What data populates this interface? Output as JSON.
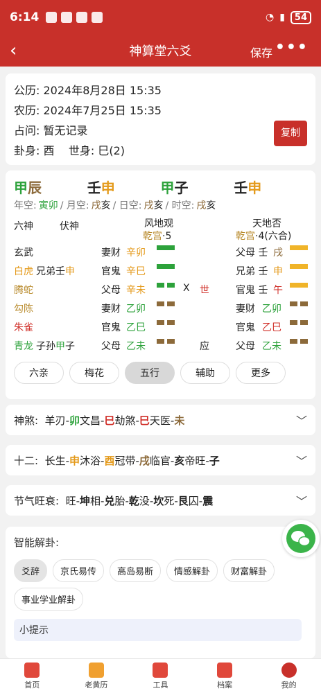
{
  "status": {
    "time": "6:14",
    "battery": "54"
  },
  "nav": {
    "back": "‹",
    "title": "神算堂六爻",
    "save": "保存",
    "more": "•••"
  },
  "info": {
    "gongli_label": "公历:",
    "gongli": "2024年8月28日 15:35",
    "nongli_label": "农历:",
    "nongli": "2024年7月25日 15:35",
    "zhanwen_label": "占问:",
    "zhanwen": "暂无记录",
    "guashen_label": "卦身:",
    "guashen": "酉",
    "shishen_label": "世身:",
    "shishen": "巳(2)",
    "copy": "复制"
  },
  "ganzhi": [
    {
      "gan": "甲",
      "zhi": "辰"
    },
    {
      "gan": "壬",
      "zhi": "申"
    },
    {
      "gan": "甲",
      "zhi": "子"
    },
    {
      "gan": "壬",
      "zhi": "申"
    }
  ],
  "kong": {
    "nian_label": "年空:",
    "nian": "寅卯",
    "yue_label": "/ 月空:",
    "yue_a": "戌",
    "yue_b": "亥",
    "ri_label": "/ 日空:",
    "ri_a": "戌",
    "ri_b": "亥",
    "shi_label": "/ 时空:",
    "shi_a": "戌",
    "shi_b": "亥"
  },
  "head": {
    "liushen": "六神",
    "fushen": "伏神",
    "ben_name": "风地观",
    "ben_gong": "乾宫",
    "ben_num": "·5",
    "bian_name": "天地否",
    "bian_gong": "乾宫",
    "bian_num": "·4(六合)"
  },
  "yao": [
    {
      "shen": "玄武",
      "fu": "",
      "fu_zhi": "",
      "fu_rest": "",
      "ben_a": "妻财",
      "ben_b": "辛卯",
      "line": "yang-g",
      "mark": "",
      "bian_a": "父母 壬",
      "bian_b": "戌",
      "bline": "yang-o"
    },
    {
      "shen": "白虎",
      "fu": "兄弟壬",
      "fu_zhi": "申",
      "fu_rest": "",
      "ben_a": "官鬼",
      "ben_b": "辛巳",
      "line": "yang-g",
      "mark": "",
      "bian_a": "兄弟 壬",
      "bian_b": "申",
      "bline": "yang-o"
    },
    {
      "shen": "腾蛇",
      "fu": "",
      "fu_zhi": "",
      "fu_rest": "",
      "ben_a": "父母",
      "ben_b": "辛未",
      "line": "yin-g",
      "mark": "X",
      "shi": "世",
      "bian_a": "官鬼 壬",
      "bian_b": "午",
      "bline": "yang-o"
    },
    {
      "shen": "勾陈",
      "fu": "",
      "fu_zhi": "",
      "fu_rest": "",
      "ben_a": "妻财",
      "ben_b": "乙卯",
      "line": "yin-b",
      "mark": "",
      "bian_a": "妻财",
      "bian_b": "乙卯",
      "bline": "yin-b"
    },
    {
      "shen": "朱雀",
      "fu": "",
      "fu_zhi": "",
      "fu_rest": "",
      "ben_a": "官鬼",
      "ben_b": "乙巳",
      "line": "yin-b",
      "mark": "",
      "bian_a": "官鬼",
      "bian_b": "乙巳",
      "bline": "yin-b"
    },
    {
      "shen": "青龙",
      "fu": "子孙",
      "fu_zhi": "甲",
      "fu_rest": "子",
      "ben_a": "父母",
      "ben_b": "乙未",
      "line": "yin-b",
      "mark": "应",
      "bian_a": "父母",
      "bian_b": "乙未",
      "bline": "yin-b"
    }
  ],
  "tabs": [
    "六亲",
    "梅花",
    "五行",
    "辅助",
    "更多"
  ],
  "shensha": {
    "label": "神煞:",
    "a": "羊刃-",
    "a2": "卯",
    "b": " 文昌-",
    "b2": "巳",
    "c": " 劫煞-",
    "c2": "巳",
    "d": " 天医-",
    "d2": "未"
  },
  "shier": {
    "label": "十二:",
    "a": "长生-",
    "a2": "申",
    "b": " 沐浴-",
    "b2": "酉",
    "c": " 冠带-",
    "c2": "戌",
    "d": " 临官-",
    "d2": "亥",
    "e": " 帝旺-",
    "e2": "子"
  },
  "jieqi": {
    "label": "节气旺衰:",
    "a": "旺-",
    "a2": "坤",
    "b": " 相-",
    "b2": "兑",
    "c": " 胎-",
    "c2": "乾",
    "d": " 没-",
    "d2": "坎",
    "e": " 死-",
    "e2": "艮",
    "f": " 囚-",
    "f2": "震"
  },
  "smart": {
    "title": "智能解卦:",
    "chips": [
      "爻辞",
      "京氏易传",
      "高岛易断",
      "情感解卦",
      "财富解卦",
      "事业学业解卦"
    ],
    "tip": "小提示"
  },
  "tabbar": [
    "首页",
    "老黄历",
    "工具",
    "档案",
    "我的"
  ]
}
